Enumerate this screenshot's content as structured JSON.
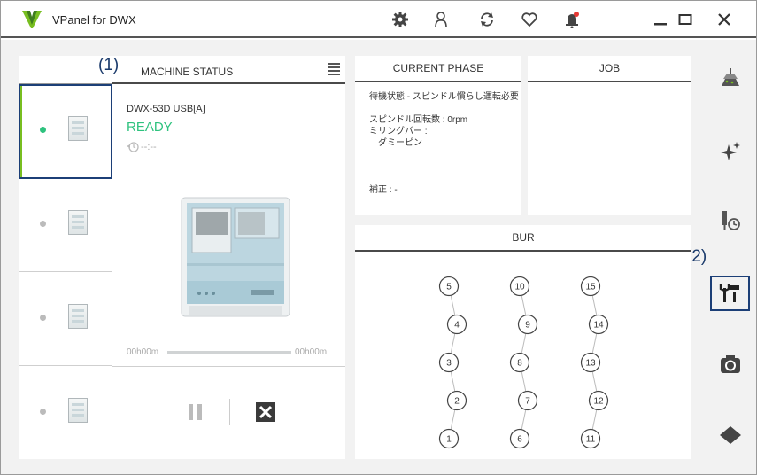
{
  "app": {
    "title": "VPanel for DWX"
  },
  "colors": {
    "accent_green": "#78be20",
    "ready_green": "#2ec27e",
    "callout_blue": "#1c3f77",
    "alert_red": "#e53935"
  },
  "callouts": {
    "c1": "(1)",
    "c2": "(2)"
  },
  "machine_status": {
    "title": "MACHINE STATUS",
    "machines": [
      {
        "active": true
      },
      {
        "active": false
      },
      {
        "active": false
      },
      {
        "active": false
      }
    ],
    "selected": {
      "name": "DWX-53D USB[A]",
      "state": "READY",
      "time": "--:--",
      "elapsed": "00h00m",
      "remaining": "00h00m",
      "progress": 0
    }
  },
  "current_phase": {
    "title": "CURRENT PHASE",
    "line1": "待機状態 - スピンドル慣らし運転必要",
    "line2": "スピンドル回転数 : 0rpm",
    "line3": "ミリングバー :",
    "line4": "ダミーピン",
    "line5": "補正 : -"
  },
  "job": {
    "title": "JOB"
  },
  "bur": {
    "title": "BUR",
    "slots": [
      "1",
      "2",
      "3",
      "4",
      "5",
      "6",
      "7",
      "8",
      "9",
      "10",
      "11",
      "12",
      "13",
      "14",
      "15"
    ]
  },
  "icons": {
    "titlebar": [
      "gear-icon",
      "user-icon",
      "refresh-icon",
      "heart-icon",
      "bell-icon",
      "minimize-icon",
      "maximize-icon",
      "close-icon"
    ],
    "sidebar": [
      "milling-icon",
      "sparkle-icon",
      "bur-timer-icon",
      "tools-icon",
      "camera-icon",
      "diamond-icon"
    ]
  }
}
